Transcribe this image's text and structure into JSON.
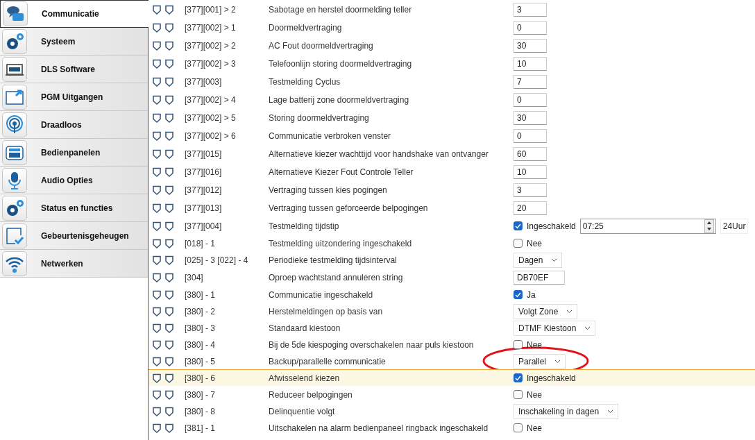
{
  "sidebar": {
    "items": [
      {
        "label": "Communicatie",
        "selected": true
      },
      {
        "label": "Systeem",
        "selected": false
      },
      {
        "label": "DLS Software",
        "selected": false
      },
      {
        "label": "PGM Uitgangen",
        "selected": false
      },
      {
        "label": "Draadloos",
        "selected": false
      },
      {
        "label": "Bedienpanelen",
        "selected": false
      },
      {
        "label": "Audio Opties",
        "selected": false
      },
      {
        "label": "Status en functies",
        "selected": false
      },
      {
        "label": "Gebeurtenisgeheugen",
        "selected": false
      },
      {
        "label": "Netwerken",
        "selected": false
      }
    ]
  },
  "rows": [
    {
      "code": "[377][001] > 2",
      "description": "Sabotage en herstel doormelding teller",
      "selected": false,
      "field": {
        "kind": "number",
        "value": "3"
      }
    },
    {
      "code": "[377][002] > 1",
      "description": "Doormeldvertraging",
      "selected": false,
      "field": {
        "kind": "number",
        "value": "0"
      }
    },
    {
      "code": "[377][002] > 2",
      "description": "AC Fout doormeldvertraging",
      "selected": false,
      "field": {
        "kind": "number",
        "value": "30"
      }
    },
    {
      "code": "[377][002] > 3",
      "description": "Telefoonlijn storing doormeldvertraging",
      "selected": false,
      "field": {
        "kind": "number",
        "value": "10"
      }
    },
    {
      "code": "[377][003]",
      "description": "Testmelding Cyclus",
      "selected": false,
      "field": {
        "kind": "number",
        "value": "7"
      }
    },
    {
      "code": "[377][002] > 4",
      "description": "Lage batterij zone doormeldvertraging",
      "selected": false,
      "field": {
        "kind": "number",
        "value": "0"
      }
    },
    {
      "code": "[377][002] > 5",
      "description": "Storing doormeldvertraging",
      "selected": false,
      "field": {
        "kind": "number",
        "value": "30"
      }
    },
    {
      "code": "[377][002] > 6",
      "description": "Communicatie verbroken venster",
      "selected": false,
      "field": {
        "kind": "number",
        "value": "0"
      }
    },
    {
      "code": "[377][015]",
      "description": "Alternatieve kiezer wachttijd voor handshake van ontvanger",
      "selected": false,
      "field": {
        "kind": "number",
        "value": "60"
      }
    },
    {
      "code": "[377][016]",
      "description": "Alternatieve Kiezer Fout Controle Teller",
      "selected": false,
      "field": {
        "kind": "number",
        "value": "10"
      }
    },
    {
      "code": "[377][012]",
      "description": "Vertraging tussen kies pogingen",
      "selected": false,
      "field": {
        "kind": "number",
        "value": "3"
      }
    },
    {
      "code": "[377][013]",
      "description": "Vertraging tussen geforceerde belpogingen",
      "selected": false,
      "field": {
        "kind": "number",
        "value": "20"
      }
    },
    {
      "code": "[377][004]",
      "description": "Testmelding tijdstip",
      "selected": false,
      "field": {
        "kind": "time",
        "checked": true,
        "label": "Ingeschakeld",
        "value": "07:25",
        "suffix": "24Uur"
      }
    },
    {
      "code": "[018] - 1",
      "description": "Testmelding uitzondering ingeschakeld",
      "selected": false,
      "field": {
        "kind": "checkbox",
        "checked": false,
        "label": "Nee"
      }
    },
    {
      "code": "[025] - 3 [022] - 4",
      "description": "Periodieke testmelding tijdsinterval",
      "selected": false,
      "field": {
        "kind": "select",
        "value": "Dagen"
      }
    },
    {
      "code": "[304]",
      "description": "Oproep wachtstand annuleren string",
      "selected": false,
      "field": {
        "kind": "text",
        "value": "DB70EF"
      }
    },
    {
      "code": "[380] - 1",
      "description": "Communicatie ingeschakeld",
      "selected": false,
      "field": {
        "kind": "checkbox",
        "checked": true,
        "label": "Ja"
      }
    },
    {
      "code": "[380] - 2",
      "description": "Herstelmeldingen op basis van",
      "selected": false,
      "field": {
        "kind": "select",
        "value": "Volgt Zone"
      }
    },
    {
      "code": "[380] - 3",
      "description": "Standaard kiestoon",
      "selected": false,
      "field": {
        "kind": "select",
        "value": "DTMF Kiestoon"
      }
    },
    {
      "code": "[380] - 4",
      "description": "Bij de 5de kiespoging overschakelen naar puls kiestoon",
      "selected": false,
      "field": {
        "kind": "checkbox",
        "checked": false,
        "label": "Nee"
      }
    },
    {
      "code": "[380] - 5",
      "description": "Backup/parallelle communicatie",
      "selected": false,
      "field": {
        "kind": "select",
        "value": "Parallel",
        "circled": true
      }
    },
    {
      "code": "[380] - 6",
      "description": "Afwisselend kiezen",
      "selected": true,
      "field": {
        "kind": "checkbox",
        "checked": true,
        "label": "Ingeschakeld"
      }
    },
    {
      "code": "[380] - 7",
      "description": "Reduceer belpogingen",
      "selected": false,
      "field": {
        "kind": "checkbox",
        "checked": false,
        "label": "Nee"
      }
    },
    {
      "code": "[380] - 8",
      "description": "Delinquentie volgt",
      "selected": false,
      "field": {
        "kind": "select",
        "value": "Inschakeling in dagen"
      }
    },
    {
      "code": "[381] - 1",
      "description": "Uitschakelen na alarm bedienpaneel ringback ingeschakeld",
      "selected": false,
      "field": {
        "kind": "checkbox",
        "checked": false,
        "label": "Nee"
      }
    }
  ]
}
